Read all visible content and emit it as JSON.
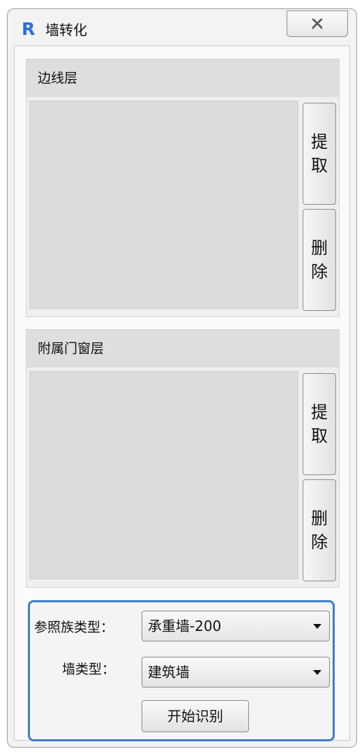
{
  "window": {
    "title": "墙转化",
    "app_icon_letter": "R",
    "close_icon": "close-icon"
  },
  "groups": [
    {
      "header": "边线层",
      "pick_button": [
        "提",
        "取"
      ],
      "delete_button": [
        "删",
        "除"
      ]
    },
    {
      "header": "附属门窗层",
      "pick_button": [
        "提",
        "取"
      ],
      "delete_button": [
        "删",
        "除"
      ]
    }
  ],
  "settings": {
    "ref_family_label": "参照族类型：",
    "ref_family_value": "承重墙-200",
    "wall_type_label": "墙类型：",
    "wall_type_value": "建筑墙",
    "start_button": "开始识别"
  },
  "colors": {
    "accent": "#3d7fc6",
    "app_icon": "#2b6fd0"
  }
}
